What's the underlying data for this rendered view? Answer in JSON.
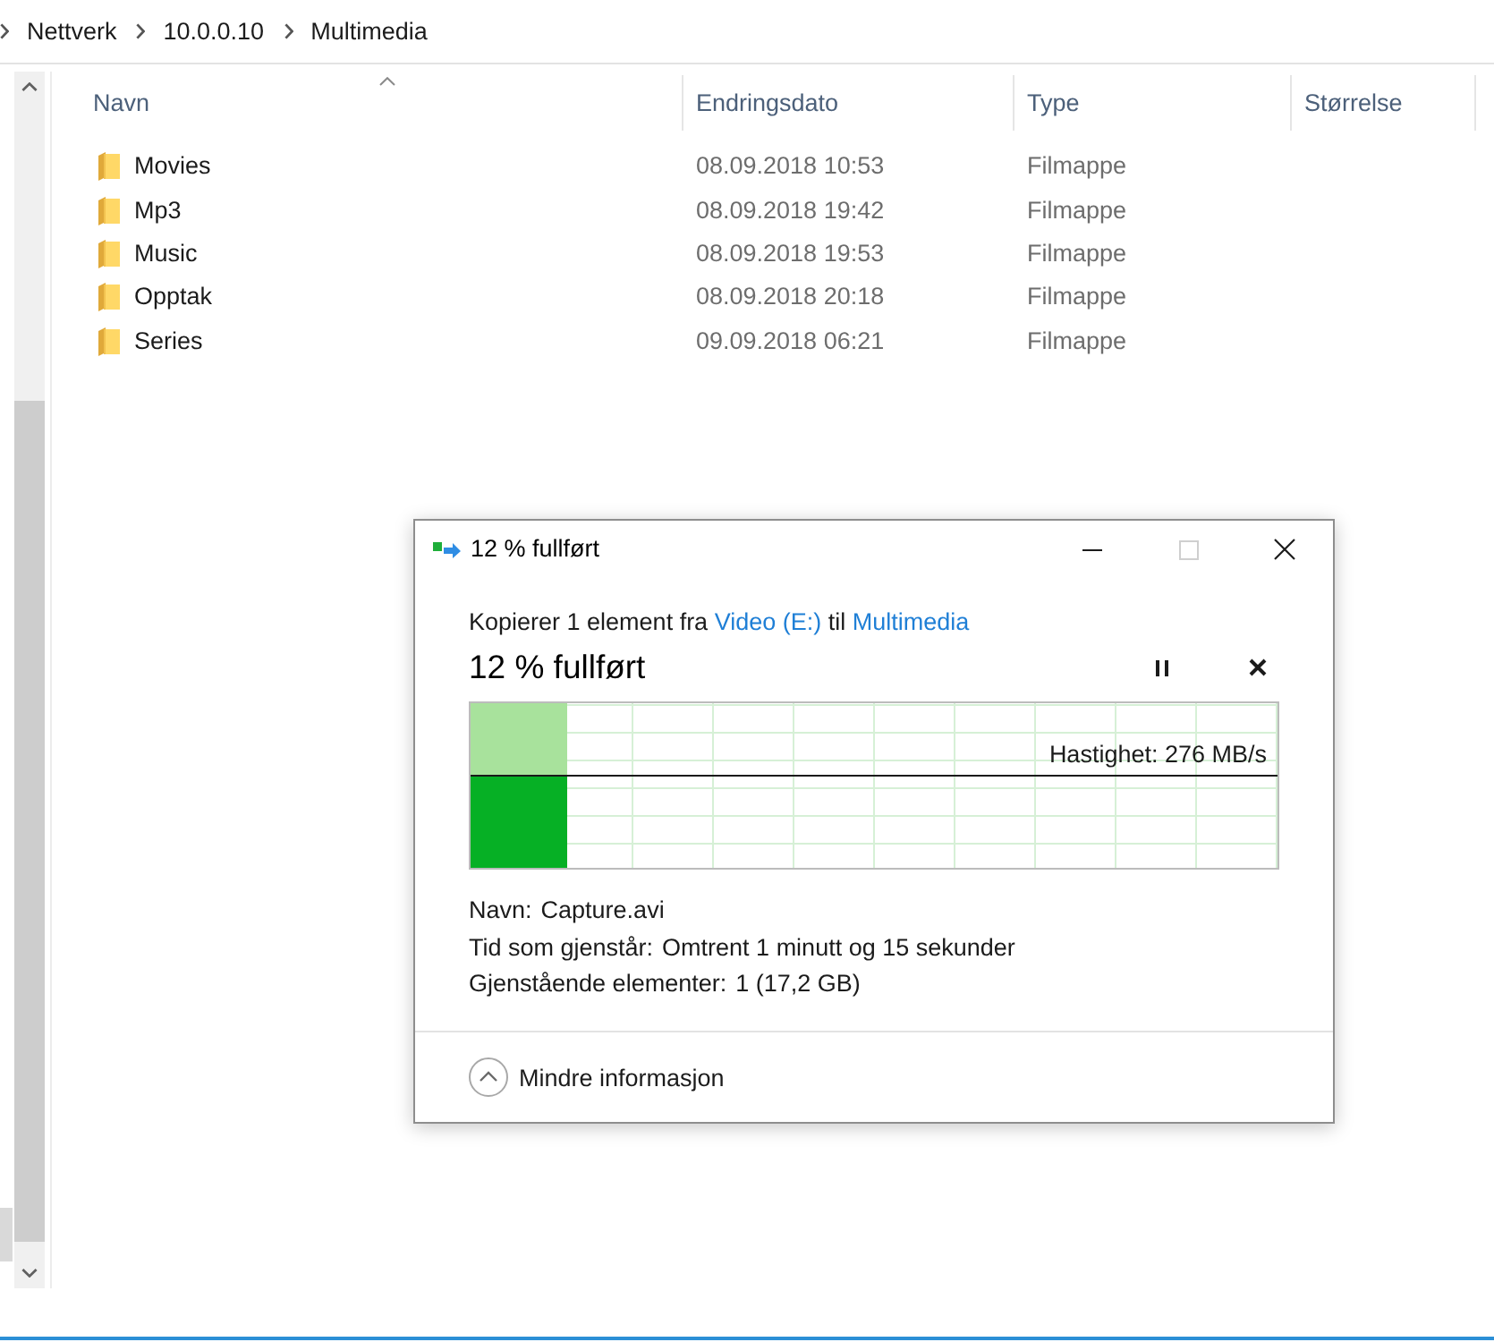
{
  "address_bar": {
    "breadcrumbs": [
      {
        "label": "Nettverk"
      },
      {
        "label": "10.0.0.10"
      },
      {
        "label": "Multimedia"
      }
    ]
  },
  "file_list": {
    "columns": [
      {
        "label": "Navn",
        "sorted": true
      },
      {
        "label": "Endringsdato",
        "sorted": false
      },
      {
        "label": "Type",
        "sorted": false
      },
      {
        "label": "Størrelse",
        "sorted": false
      }
    ],
    "rows": [
      {
        "name": "Movies",
        "modified": "08.09.2018 10:53",
        "type": "Filmappe"
      },
      {
        "name": "Mp3",
        "modified": "08.09.2018 19:42",
        "type": "Filmappe"
      },
      {
        "name": "Music",
        "modified": "08.09.2018 19:53",
        "type": "Filmappe"
      },
      {
        "name": "Opptak",
        "modified": "08.09.2018 20:18",
        "type": "Filmappe"
      },
      {
        "name": "Series",
        "modified": "09.09.2018 06:21",
        "type": "Filmappe"
      }
    ]
  },
  "copy_dialog": {
    "title": "12 % fullført",
    "window_controls": [
      {
        "kind": "minimize",
        "disabled": false
      },
      {
        "kind": "maximize",
        "disabled": true
      },
      {
        "kind": "close",
        "disabled": false
      }
    ],
    "description": [
      {
        "kind": "text",
        "text": "Kopierer 1 element fra"
      },
      {
        "kind": "link",
        "text": "Video (E:)"
      },
      {
        "kind": "text",
        "text": "til"
      },
      {
        "kind": "link",
        "text": "Multimedia"
      }
    ],
    "status": "12 % fullført",
    "actions": [
      {
        "kind": "pause"
      },
      {
        "kind": "cancel"
      }
    ],
    "progress": {
      "level": 0.12,
      "speed": "Hastighet: 276 MB/s"
    },
    "details": [
      {
        "label": "Navn:",
        "value": "Capture.avi"
      },
      {
        "label": "Tid som gjenstår:",
        "value": "Omtrent 1 minutt og 15 sekunder"
      },
      {
        "label": "Gjenstående elementer:",
        "value": "1 (17,2 GB)"
      }
    ],
    "toggle": {
      "label": "Mindre informasjon",
      "expanded": true
    }
  }
}
